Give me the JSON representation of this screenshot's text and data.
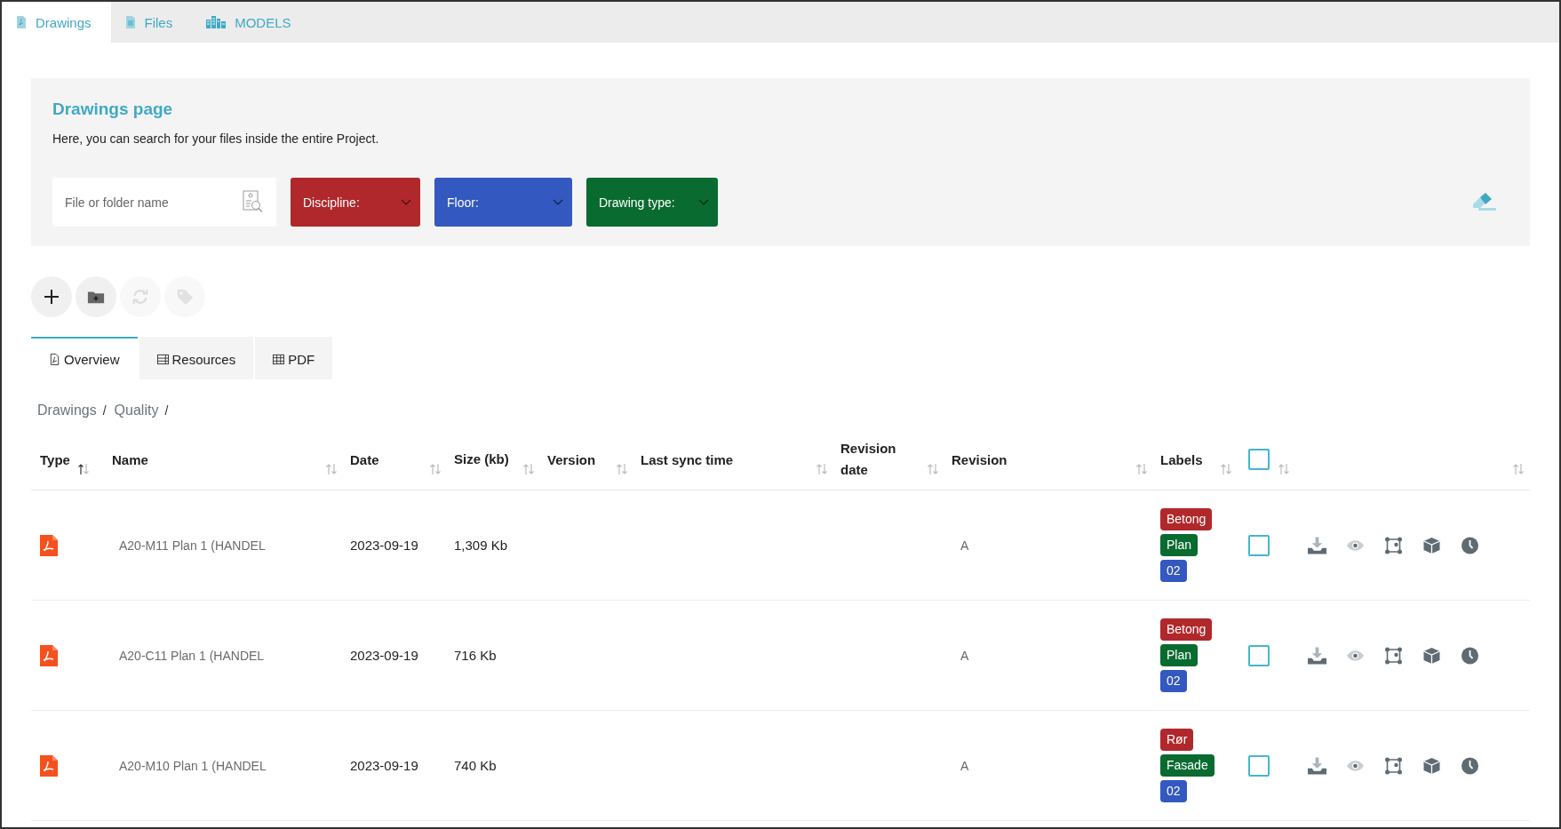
{
  "tabs": [
    {
      "label": "Drawings",
      "selected": true,
      "kind": "pdf"
    },
    {
      "label": "Files",
      "selected": false,
      "kind": "file"
    },
    {
      "label": "MODELS",
      "selected": false,
      "kind": "buildings"
    }
  ],
  "header": {
    "title": "Drawings page",
    "description": "Here, you can search for your files inside the entire Project."
  },
  "search": {
    "placeholder": "File or folder name"
  },
  "filters": [
    {
      "label": "Discipline:",
      "color": "#b0282b"
    },
    {
      "label": "Floor:",
      "color": "#3358c0"
    },
    {
      "label": "Drawing type:",
      "color": "#0a6b30"
    }
  ],
  "toolbar": [
    {
      "kind": "add",
      "disabled": false
    },
    {
      "kind": "folder",
      "disabled": false
    },
    {
      "kind": "refresh",
      "disabled": true
    },
    {
      "kind": "tag",
      "disabled": true
    }
  ],
  "view_tabs": [
    {
      "label": "Overview",
      "selected": true,
      "kind": "pdf"
    },
    {
      "label": "Resources",
      "selected": false,
      "kind": "list"
    },
    {
      "label": "PDF",
      "selected": false,
      "kind": "grid"
    }
  ],
  "breadcrumb": {
    "items": [
      "Drawings",
      "Quality"
    ],
    "separator": "/"
  },
  "table": {
    "columns": [
      {
        "label": "Type",
        "sorted": true
      },
      {
        "label": "Name",
        "sorted": false
      },
      {
        "label": "Date",
        "sorted": false
      },
      {
        "label": "Size (kb)",
        "sorted": false
      },
      {
        "label": "Version",
        "sorted": false
      },
      {
        "label": "Last sync time",
        "sorted": false
      },
      {
        "label": "Revision date",
        "sorted": false
      },
      {
        "label": "Revision",
        "sorted": false
      },
      {
        "label": "Labels",
        "sorted": false
      },
      {
        "kind": "select",
        "checked": false,
        "sorted": false
      },
      {
        "kind": "actions",
        "sorted": false
      }
    ],
    "rows": [
      {
        "name": "A20-M11 Plan 1 (HANDEL",
        "date": "2023-09-19",
        "size": "1,309 Kb",
        "revision": "A",
        "checked": false,
        "labels": [
          {
            "text": "Betong",
            "color": "#b0282b"
          },
          {
            "text": "Plan",
            "color": "#0a6b30"
          },
          {
            "text": "02",
            "color": "#3358c0"
          }
        ]
      },
      {
        "name": "A20-C11 Plan 1 (HANDEL",
        "date": "2023-09-19",
        "size": "716 Kb",
        "revision": "A",
        "checked": false,
        "labels": [
          {
            "text": "Betong",
            "color": "#b0282b"
          },
          {
            "text": "Plan",
            "color": "#0a6b30"
          },
          {
            "text": "02",
            "color": "#3358c0"
          }
        ]
      },
      {
        "name": "A20-M10 Plan 1 (HANDEL",
        "date": "2023-09-19",
        "size": "740 Kb",
        "revision": "A",
        "checked": false,
        "labels": [
          {
            "text": "Rør",
            "color": "#b0282b"
          },
          {
            "text": "Fasade",
            "color": "#0a6b30"
          },
          {
            "text": "02",
            "color": "#3358c0"
          }
        ]
      }
    ]
  }
}
